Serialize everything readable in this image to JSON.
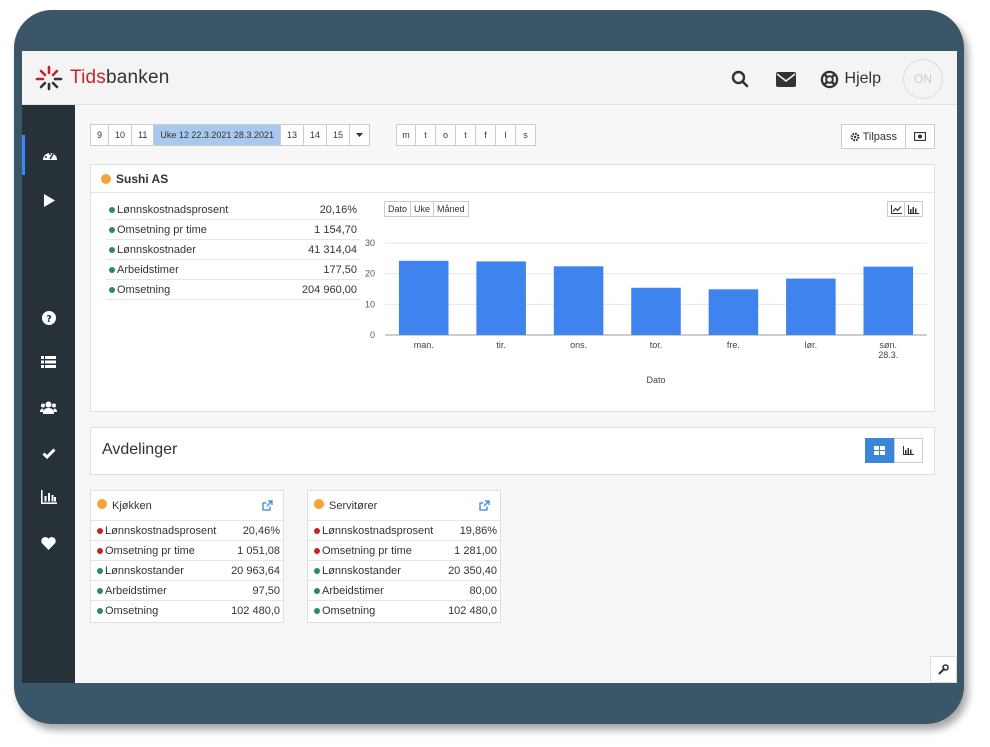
{
  "app": {
    "logo_part1": "Tids",
    "logo_part2": "banken",
    "help_label": "Hjelp",
    "user_button_label": "ON",
    "accent_color": "#3a86d8",
    "brand_color": "#c8232c"
  },
  "topbar_icons": [
    "search-icon",
    "envelope-icon",
    "lifebuoy-icon"
  ],
  "sidebar_icons": [
    "dashboard-icon",
    "play-icon",
    "question-icon",
    "list-icon",
    "users-icon",
    "check-icon",
    "bar-chart-icon",
    "heart-icon"
  ],
  "week_nav": {
    "weeks": [
      "9",
      "10",
      "11",
      "Uke 12 22.3.2021 28.3.2021",
      "13",
      "14",
      "15"
    ],
    "active_index": 3,
    "dropdown_icon": "caret-down-icon",
    "days": [
      "m",
      "t",
      "o",
      "t",
      "f",
      "l",
      "s"
    ]
  },
  "toolbar": {
    "customize_label": "Tilpass",
    "customize_icon": "gear-icon",
    "screen_icon": "camera-icon"
  },
  "company": {
    "name": "Sushi AS",
    "kpis": [
      {
        "label": "Lønnskostnadsprosent",
        "value": "20,16%",
        "status": "green"
      },
      {
        "label": "Omsetning pr time",
        "value": "1 154,70",
        "status": "green"
      },
      {
        "label": "Lønnskostnader",
        "value": "41 314,04",
        "status": "green"
      },
      {
        "label": "Arbeidstimer",
        "value": "177,50",
        "status": "green"
      },
      {
        "label": "Omsetning",
        "value": "204 960,00",
        "status": "green"
      }
    ],
    "period_tabs": [
      "Dato",
      "Uke",
      "Måned"
    ]
  },
  "chart_data": {
    "type": "bar",
    "categories": [
      "man.",
      "tir.",
      "ons.",
      "tor.",
      "fre.",
      "lør.",
      "søn.\n28.3."
    ],
    "values": [
      24.2,
      24.0,
      22.4,
      15.4,
      14.9,
      18.4,
      22.3
    ],
    "xlabel": "Dato",
    "ylabel": "",
    "ylim": [
      0,
      30
    ],
    "yticks": [
      0,
      10,
      20,
      30
    ],
    "grid": true,
    "bar_color": "#3f84ee"
  },
  "departments_title": "Avdelinger",
  "departments": [
    {
      "name": "Kjøkken",
      "kpis": [
        {
          "label": "Lønnskostnadsprosent",
          "value": "20,46%",
          "status": "red"
        },
        {
          "label": "Omsetning pr time",
          "value": "1 051,08",
          "status": "red"
        },
        {
          "label": "Lønnskostander",
          "value": "20 963,64",
          "status": "green"
        },
        {
          "label": "Arbeidstimer",
          "value": "97,50",
          "status": "green"
        },
        {
          "label": "Omsetning",
          "value": "102 480,0",
          "status": "green"
        }
      ]
    },
    {
      "name": "Servitører",
      "kpis": [
        {
          "label": "Lønnskostnadsprosent",
          "value": "19,86%",
          "status": "red"
        },
        {
          "label": "Omsetning pr time",
          "value": "1 281,00",
          "status": "red"
        },
        {
          "label": "Lønnskostander",
          "value": "20 350,40",
          "status": "green"
        },
        {
          "label": "Arbeidstimer",
          "value": "80,00",
          "status": "green"
        },
        {
          "label": "Omsetning",
          "value": "102 480,0",
          "status": "green"
        }
      ]
    }
  ]
}
